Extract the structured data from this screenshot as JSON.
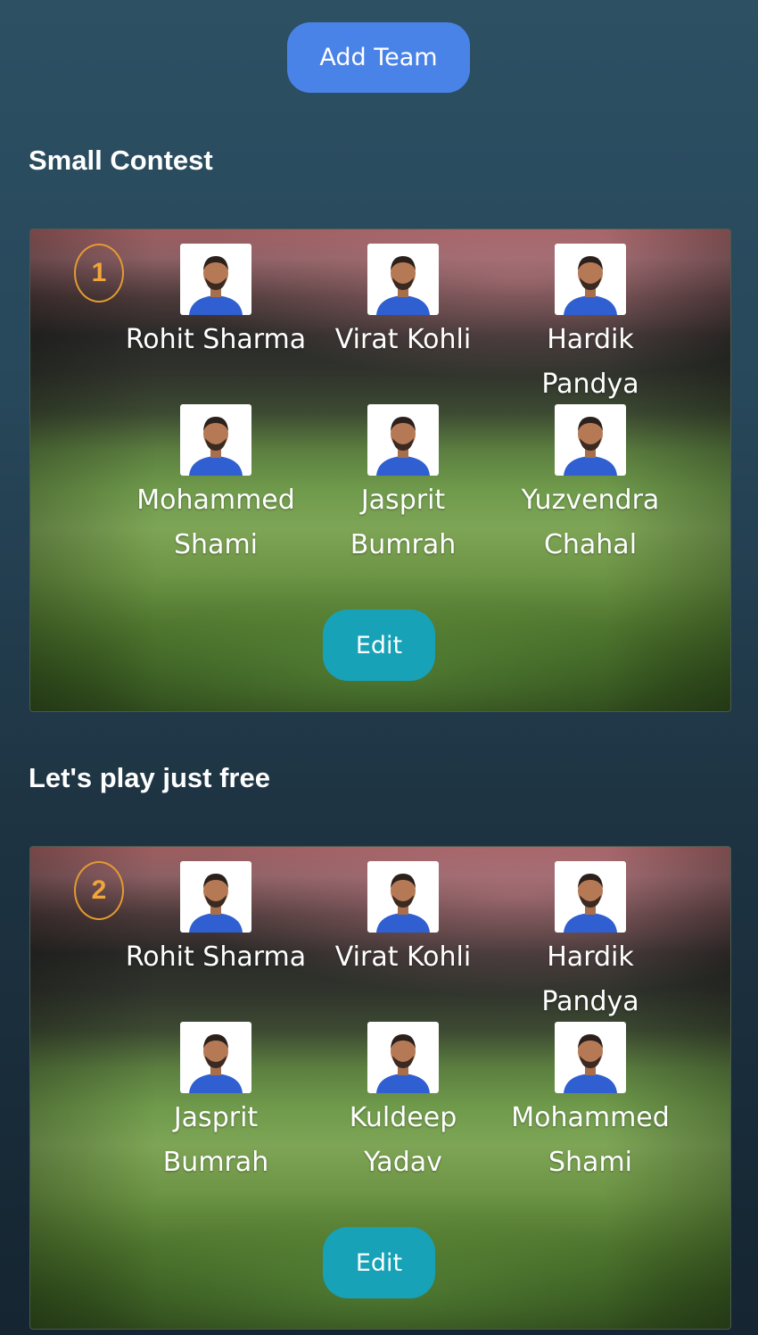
{
  "header": {
    "add_team_label": "Add Team"
  },
  "teams": [
    {
      "contest_title": "Small Contest",
      "number": "1",
      "edit_label": "Edit",
      "players": [
        {
          "name": "Rohit Sharma",
          "icon": "player-photo"
        },
        {
          "name": "Virat Kohli",
          "icon": "player-photo"
        },
        {
          "name": "Hardik Pandya",
          "icon": "player-photo"
        },
        {
          "name": "Mohammed Shami",
          "icon": "player-photo"
        },
        {
          "name": "Jasprit Bumrah",
          "icon": "player-photo"
        },
        {
          "name": "Yuzvendra Chahal",
          "icon": "player-photo"
        }
      ]
    },
    {
      "contest_title": "Let's play just free",
      "number": "2",
      "edit_label": "Edit",
      "players": [
        {
          "name": "Rohit Sharma",
          "icon": "player-photo"
        },
        {
          "name": "Virat Kohli",
          "icon": "player-photo"
        },
        {
          "name": "Hardik Pandya",
          "icon": "player-photo"
        },
        {
          "name": "Jasprit Bumrah",
          "icon": "player-photo"
        },
        {
          "name": "Kuldeep Yadav",
          "icon": "player-photo"
        },
        {
          "name": "Mohammed Shami",
          "icon": "player-photo"
        }
      ]
    }
  ],
  "colors": {
    "add_team_button": "#4a83e8",
    "edit_button": "#17a2b8",
    "team_number_accent": "#e39a32",
    "jersey_blue": "#2f5fd0"
  }
}
